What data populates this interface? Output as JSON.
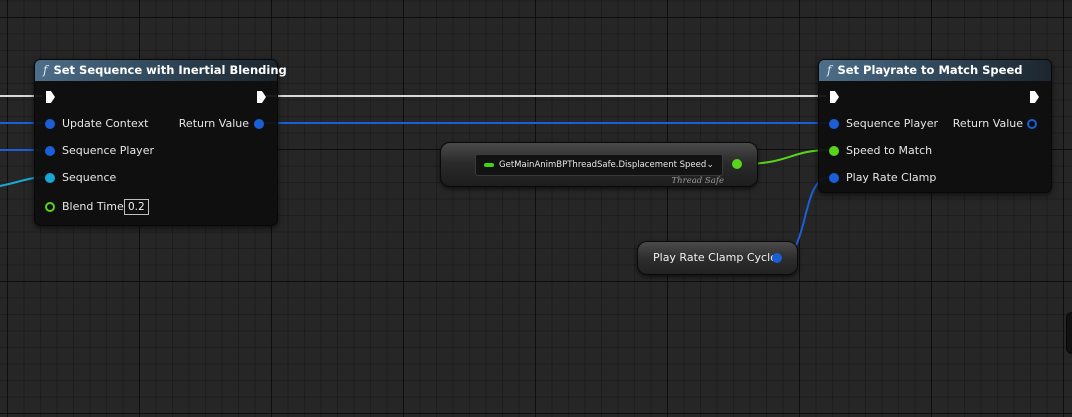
{
  "graph": {
    "node_set_sequence": {
      "title": "Set Sequence with Inertial Blending",
      "function_icon": "f",
      "pins": {
        "update_context": "Update Context",
        "sequence_player": "Sequence Player",
        "sequence": "Sequence",
        "blend_time": "Blend Time",
        "blend_time_value": "0.2",
        "return_value": "Return Value"
      }
    },
    "node_getter": {
      "value_label": "GetMainAnimBPThreadSafe.Displacement Speed",
      "chevron": "⌄",
      "thread_safe_label": "Thread Safe"
    },
    "node_play_rate_clamp_cycle": {
      "label": "Play Rate Clamp Cycle"
    },
    "node_set_playrate": {
      "title": "Set Playrate to Match Speed",
      "function_icon": "f",
      "pins": {
        "sequence_player": "Sequence Player",
        "speed_to_match": "Speed to Match",
        "play_rate_clamp": "Play Rate Clamp",
        "return_value": "Return Value"
      }
    },
    "colors": {
      "background": "#262626",
      "exec_wire": "#ffffff",
      "struct_wire": "#1a5fd6",
      "float_wire": "#5ad41a",
      "header": "#4d6e8a"
    }
  }
}
